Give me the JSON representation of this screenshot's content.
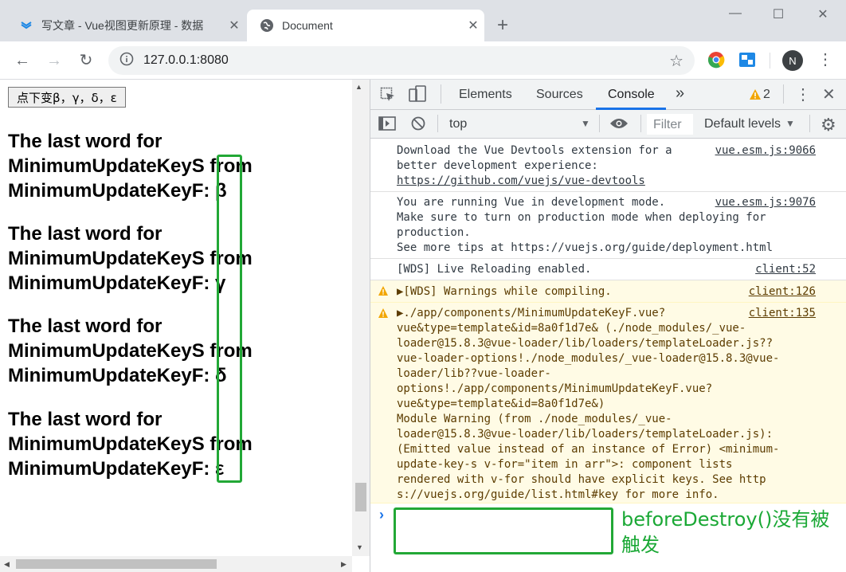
{
  "browser": {
    "tabs": [
      {
        "title": "写文章 - Vue视图更新原理 - 数据",
        "close": "✕"
      },
      {
        "title": "Document",
        "close": "✕"
      }
    ],
    "new_tab": "+",
    "url": "127.0.0.1:8080",
    "profile_initial": "N"
  },
  "page": {
    "button_label": "点下变β，γ，δ，ε",
    "items": [
      {
        "line1": "The last word for",
        "line2": "MinimumUpdateKeyS from",
        "line3": "MinimumUpdateKeyF: β"
      },
      {
        "line1": "The last word for",
        "line2": "MinimumUpdateKeyS from",
        "line3": "MinimumUpdateKeyF: γ"
      },
      {
        "line1": "The last word for",
        "line2": "MinimumUpdateKeyS from",
        "line3": "MinimumUpdateKeyF: δ"
      },
      {
        "line1": "The last word for",
        "line2": "MinimumUpdateKeyS from",
        "line3": "MinimumUpdateKeyF: ε"
      }
    ]
  },
  "devtools": {
    "tabs": [
      "Elements",
      "Sources",
      "Console"
    ],
    "more": "»",
    "warning_count": "2",
    "context": "top",
    "filter_placeholder": "Filter",
    "levels": "Default levels",
    "messages": [
      {
        "lines": [
          "Download the Vue Devtools extension for a",
          "better development experience:",
          "https://github.com/vuejs/vue-devtools"
        ],
        "source": "vue.esm.js:9066",
        "level": "info"
      },
      {
        "lines": [
          "You are running Vue in development mode.",
          "Make sure to turn on production mode when deploying for",
          "production.",
          "See more tips at https://vuejs.org/guide/deployment.html"
        ],
        "source": "vue.esm.js:9076",
        "level": "info"
      },
      {
        "lines": [
          "[WDS] Live Reloading enabled."
        ],
        "source": "client:52",
        "level": "info"
      },
      {
        "lines": [
          "▶[WDS] Warnings while compiling."
        ],
        "source": "client:126",
        "level": "warning"
      },
      {
        "lines": [
          "▶./app/components/MinimumUpdateKeyF.vue?",
          "vue&type=template&id=8a0f1d7e& (./node_modules/_vue-",
          "loader@15.8.3@vue-loader/lib/loaders/templateLoader.js??",
          "vue-loader-options!./node_modules/_vue-loader@15.8.3@vue-",
          "loader/lib??vue-loader-",
          "options!./app/components/MinimumUpdateKeyF.vue?",
          "vue&type=template&id=8a0f1d7e&)",
          "Module Warning (from ./node_modules/_vue-",
          "loader@15.8.3@vue-loader/lib/loaders/templateLoader.js):",
          "(Emitted value instead of an instance of Error) <minimum-",
          "update-key-s v-for=\"item in arr\">: component lists",
          "rendered with v-for should have explicit keys. See http",
          "s://vuejs.org/guide/list.html#key for more info."
        ],
        "source": "client:135",
        "level": "warning"
      }
    ],
    "prompt": "›"
  },
  "annotation": {
    "line1": "beforeDestroy()没有被",
    "line2": "触发"
  },
  "colors": {
    "highlight": "#22a836",
    "annotation": "#1aa835",
    "accent": "#1a73e8"
  }
}
